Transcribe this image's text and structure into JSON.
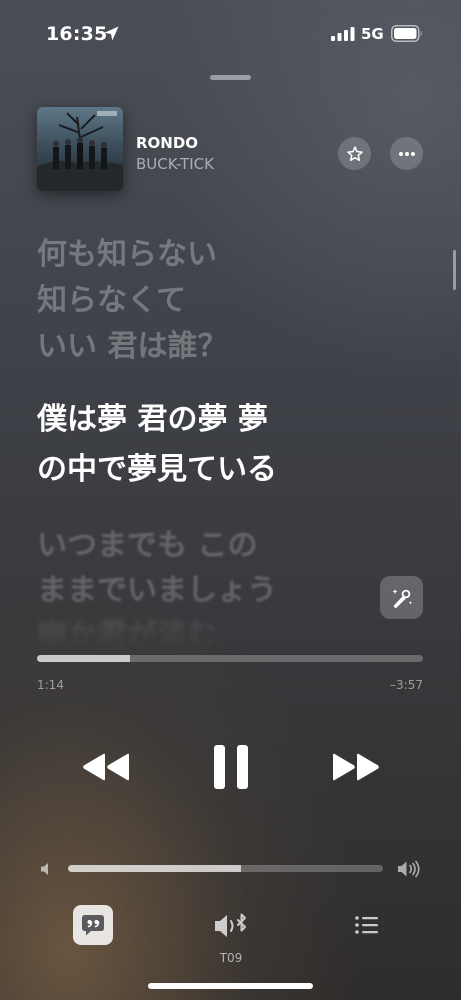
{
  "status_bar": {
    "time": "16:35",
    "network": "5G"
  },
  "now_playing": {
    "title": "RONDO",
    "artist": "BUCK-TICK"
  },
  "lyrics": {
    "previous": [
      "何も知らない",
      "知らなくて",
      "いい 君は誰？"
    ],
    "current": [
      "僕は夢 君の夢 夢",
      "の中で夢見ている"
    ],
    "upcoming": [
      "いつまでも この",
      "ままでいましょう",
      "幽か君が淡む"
    ]
  },
  "playback": {
    "elapsed": "1:14",
    "remaining": "–3:57",
    "progress": 0.24,
    "state": "playing"
  },
  "volume": {
    "level": 0.55
  },
  "bottom_bar": {
    "airplay_label": "T09"
  },
  "icons": [
    "location-arrow-icon",
    "signal-icon",
    "battery-icon",
    "star-icon",
    "more-icon",
    "sing-icon",
    "rewind-icon",
    "pause-icon",
    "forward-icon",
    "volume-low-icon",
    "volume-high-icon",
    "lyrics-icon",
    "airplay-speaker-icon",
    "queue-icon"
  ]
}
